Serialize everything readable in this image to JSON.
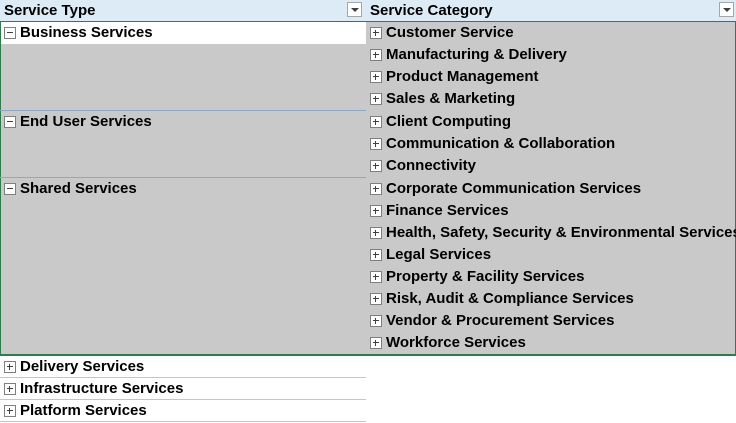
{
  "header": {
    "col1": "Service Type",
    "col2": "Service Category"
  },
  "groups": [
    {
      "label": "Business Services",
      "state": "expanded",
      "categories": [
        "Customer Service",
        "Manufacturing & Delivery",
        "Product Management",
        "Sales & Marketing"
      ]
    },
    {
      "label": "End User Services",
      "state": "expanded",
      "categories": [
        "Client Computing",
        "Communication & Collaboration",
        "Connectivity"
      ]
    },
    {
      "label": "Shared Services",
      "state": "expanded",
      "categories": [
        "Corporate Communication Services",
        "Finance Services",
        "Health, Safety, Security & Environmental Services",
        "Legal Services",
        "Property & Facility Services",
        "Risk, Audit & Compliance Services",
        "Vendor & Procurement Services",
        "Workforce Services"
      ]
    }
  ],
  "collapsed": [
    "Delivery Services",
    "Infrastructure Services",
    "Platform Services"
  ],
  "colors": {
    "header_bg": "#ddebf7",
    "group_bg": "#c9c9c9",
    "frame": "#2f7b4f"
  },
  "icons": {
    "filter": "dropdown-filter-icon",
    "expand": "expand-plus-icon",
    "collapse": "collapse-minus-icon"
  }
}
